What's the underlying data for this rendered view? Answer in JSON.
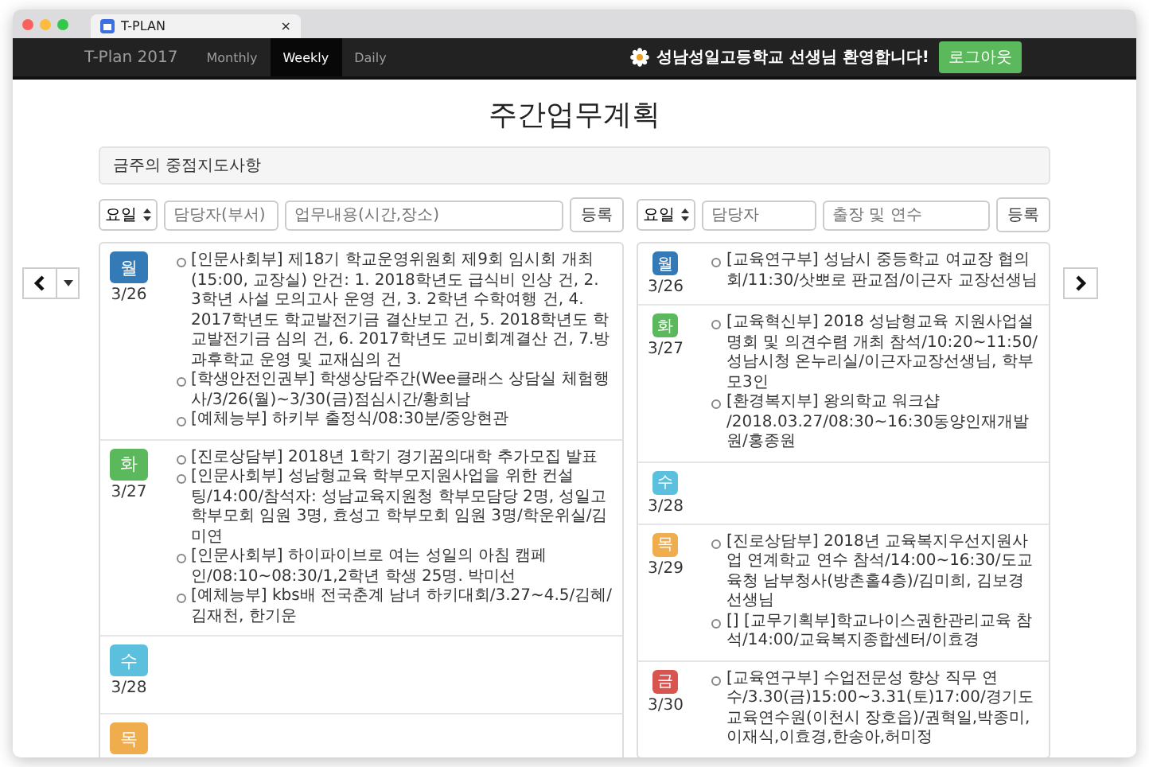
{
  "browser": {
    "tab_title": "T-PLAN",
    "tab_close": "×"
  },
  "navbar": {
    "brand": "T-Plan 2017",
    "links": [
      {
        "label": "Monthly",
        "selected": false
      },
      {
        "label": "Weekly",
        "selected": true
      },
      {
        "label": "Daily",
        "selected": false
      }
    ],
    "welcome": "성남성일고등학교 선생님 환영합니다!",
    "logout": "로그아웃"
  },
  "page_title": "주간업무계획",
  "notice": "금주의 중점지도사항",
  "left_panel": {
    "form": {
      "day_select": "요일",
      "owner_placeholder": "담당자(부서)",
      "content_placeholder": "업무내용(시간,장소)",
      "submit": "등록"
    },
    "days": [
      {
        "day": "월",
        "date": "3/26",
        "color": "#337ab7",
        "items": [
          "[인문사회부] 제18기 학교운영위원회 제9회 임시회 개최(15:00, 교장실) 안건: 1. 2018학년도 급식비 인상 건, 2. 3학년 사설 모의고사 운영 건, 3. 2학년 수학여행 건, 4. 2017학년도 학교발전기금 결산보고 건, 5. 2018학년도 학교발전기금 심의 건, 6. 2017학년도 교비회계결산 건, 7.방과후학교 운영 및 교재심의 건",
          "[학생안전인권부] 학생상담주간(Wee클래스 상담실 체험행사/3/26(월)~3/30(금)점심시간/황희남",
          "[예체능부] 하키부 출정식/08:30분/중앙현관"
        ]
      },
      {
        "day": "화",
        "date": "3/27",
        "color": "#5cb85c",
        "items": [
          "[진로상담부] 2018년 1학기 경기꿈의대학 추가모집 발표",
          "[인문사회부] 성남형교육 학부모지원사업을 위한 컨설팅/14:00/참석자: 성남교육지원청 학부모담당 2명, 성일고 학부모회 임원 3명, 효성고 학부모회 임원 3명/학운위실/김미연",
          "[인문사회부] 하이파이브로 여는 성일의 아침 캠페인/08:10~08:30/1,2학년 학생 25명. 박미선",
          "[예체능부] kbs배 전국춘계 남녀 하키대회/3.27~4.5/김혜/김재천, 한기운"
        ]
      },
      {
        "day": "수",
        "date": "3/28",
        "color": "#5bc0de"
      },
      {
        "day": "목",
        "color": "#f0ad4e"
      }
    ]
  },
  "right_panel": {
    "form": {
      "day_select": "요일",
      "owner_placeholder": "담당자",
      "content_placeholder": "출장 및 연수",
      "submit": "등록"
    },
    "days": [
      {
        "day": "월",
        "date": "3/26",
        "color": "#337ab7",
        "items": [
          "[교육연구부] 성남시 중등학교 여교장 협의회/11:30/삿뽀로 판교점/이근자 교장선생님"
        ]
      },
      {
        "day": "화",
        "date": "3/27",
        "color": "#5cb85c",
        "items": [
          "[교육혁신부] 2018 성남형교육 지원사업설명회 및 의견수렴 개최 참석/10:20~11:50/성남시청 온누리실/이근자교장선생님, 학부모3인",
          "[환경복지부] 왕의학교 워크샵 /2018.03.27/08:30~16:30동양인재개발원/홍종원"
        ]
      },
      {
        "day": "수",
        "date": "3/28",
        "color": "#5bc0de"
      },
      {
        "day": "목",
        "date": "3/29",
        "color": "#f0ad4e",
        "items": [
          "[진로상담부] 2018년 교육복지우선지원사업 연계학교 연수 참석/14:00~16:30/도교육청 남부청사(방촌홀4층)/김미희, 김보경 선생님",
          "[] [교무기획부]학교나이스권한관리교육 참석/14:00/교육복지종합센터/이효경"
        ]
      },
      {
        "day": "금",
        "date": "3/30",
        "color": "#d9534f",
        "items": [
          "[교육연구부] 수업전문성 향상 직무 연수/3.30(금)15:00~3.31(토)17:00/경기도교육연수원(이천시 장호읍)/권혁일,박종미,이재식,이효경,한송아,허미정"
        ]
      }
    ]
  }
}
